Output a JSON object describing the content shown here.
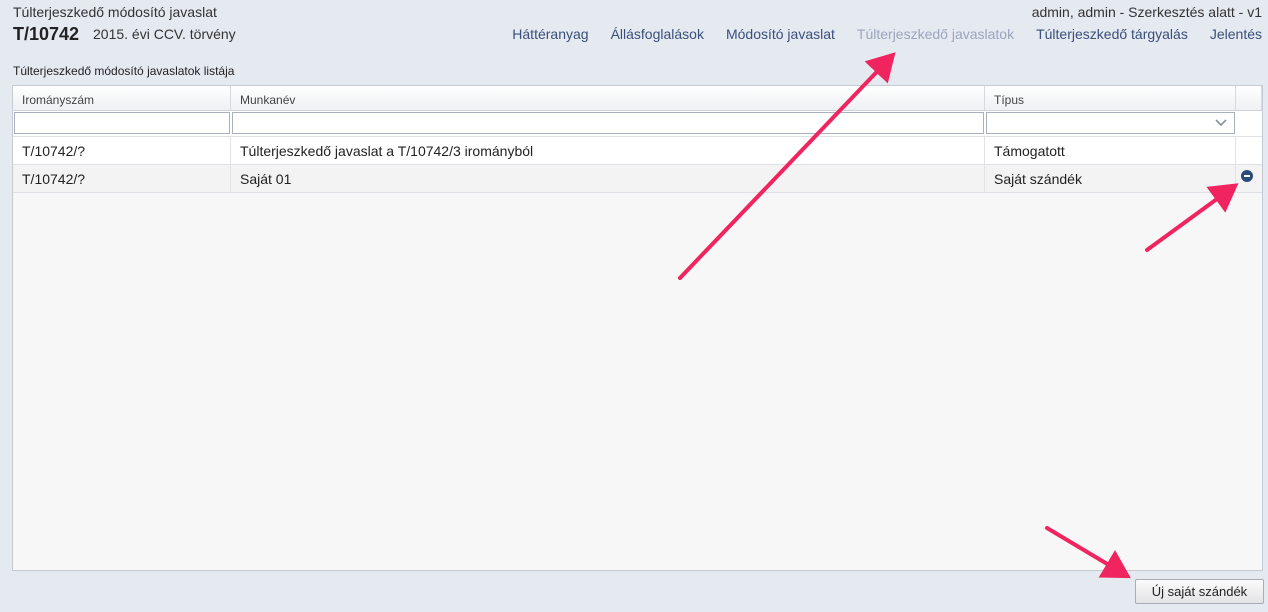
{
  "header": {
    "doc_type": "Túlterjeszkedő módosító javaslat",
    "doc_id": "T/10742",
    "doc_subtitle": "2015. évi CCV. törvény",
    "user_status": "admin, admin - Szerkesztés alatt - v1"
  },
  "nav": {
    "items": [
      {
        "label": "Háttéranyag"
      },
      {
        "label": "Állásfoglalások"
      },
      {
        "label": "Módosító javaslat"
      },
      {
        "label": "Túlterjeszkedő javaslatok"
      },
      {
        "label": "Túlterjeszkedő tárgyalás"
      },
      {
        "label": "Jelentés"
      }
    ],
    "active_index": 3
  },
  "list": {
    "title": "Túlterjeszkedő módosító javaslatok listája",
    "columns": [
      "Irományszám",
      "Munkanév",
      "Típus"
    ],
    "rows": [
      {
        "iromanyszam": "T/10742/?",
        "munkanev": "Túlterjeszkedő javaslat a T/10742/3 irományból",
        "tipus": "Támogatott"
      },
      {
        "iromanyszam": "T/10742/?",
        "munkanev": "Saját 01",
        "tipus": "Saját szándék"
      }
    ]
  },
  "actions": {
    "new_label": "Új saját szándék"
  },
  "colors": {
    "nav_link": "#3a4f7a",
    "nav_active": "#9aa6bd",
    "annotation_arrow": "#f0245f",
    "remove_icon": "#2e4a7a"
  },
  "icons": {
    "remove": "minus-circle-icon",
    "dropdown": "chevron-down-icon"
  }
}
